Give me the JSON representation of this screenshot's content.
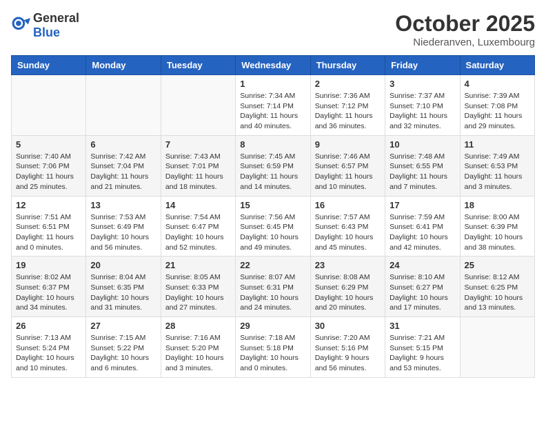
{
  "header": {
    "logo_general": "General",
    "logo_blue": "Blue",
    "month": "October 2025",
    "location": "Niederanven, Luxembourg"
  },
  "weekdays": [
    "Sunday",
    "Monday",
    "Tuesday",
    "Wednesday",
    "Thursday",
    "Friday",
    "Saturday"
  ],
  "weeks": [
    [
      {
        "day": "",
        "info": ""
      },
      {
        "day": "",
        "info": ""
      },
      {
        "day": "",
        "info": ""
      },
      {
        "day": "1",
        "info": "Sunrise: 7:34 AM\nSunset: 7:14 PM\nDaylight: 11 hours and 40 minutes."
      },
      {
        "day": "2",
        "info": "Sunrise: 7:36 AM\nSunset: 7:12 PM\nDaylight: 11 hours and 36 minutes."
      },
      {
        "day": "3",
        "info": "Sunrise: 7:37 AM\nSunset: 7:10 PM\nDaylight: 11 hours and 32 minutes."
      },
      {
        "day": "4",
        "info": "Sunrise: 7:39 AM\nSunset: 7:08 PM\nDaylight: 11 hours and 29 minutes."
      }
    ],
    [
      {
        "day": "5",
        "info": "Sunrise: 7:40 AM\nSunset: 7:06 PM\nDaylight: 11 hours and 25 minutes."
      },
      {
        "day": "6",
        "info": "Sunrise: 7:42 AM\nSunset: 7:04 PM\nDaylight: 11 hours and 21 minutes."
      },
      {
        "day": "7",
        "info": "Sunrise: 7:43 AM\nSunset: 7:01 PM\nDaylight: 11 hours and 18 minutes."
      },
      {
        "day": "8",
        "info": "Sunrise: 7:45 AM\nSunset: 6:59 PM\nDaylight: 11 hours and 14 minutes."
      },
      {
        "day": "9",
        "info": "Sunrise: 7:46 AM\nSunset: 6:57 PM\nDaylight: 11 hours and 10 minutes."
      },
      {
        "day": "10",
        "info": "Sunrise: 7:48 AM\nSunset: 6:55 PM\nDaylight: 11 hours and 7 minutes."
      },
      {
        "day": "11",
        "info": "Sunrise: 7:49 AM\nSunset: 6:53 PM\nDaylight: 11 hours and 3 minutes."
      }
    ],
    [
      {
        "day": "12",
        "info": "Sunrise: 7:51 AM\nSunset: 6:51 PM\nDaylight: 11 hours and 0 minutes."
      },
      {
        "day": "13",
        "info": "Sunrise: 7:53 AM\nSunset: 6:49 PM\nDaylight: 10 hours and 56 minutes."
      },
      {
        "day": "14",
        "info": "Sunrise: 7:54 AM\nSunset: 6:47 PM\nDaylight: 10 hours and 52 minutes."
      },
      {
        "day": "15",
        "info": "Sunrise: 7:56 AM\nSunset: 6:45 PM\nDaylight: 10 hours and 49 minutes."
      },
      {
        "day": "16",
        "info": "Sunrise: 7:57 AM\nSunset: 6:43 PM\nDaylight: 10 hours and 45 minutes."
      },
      {
        "day": "17",
        "info": "Sunrise: 7:59 AM\nSunset: 6:41 PM\nDaylight: 10 hours and 42 minutes."
      },
      {
        "day": "18",
        "info": "Sunrise: 8:00 AM\nSunset: 6:39 PM\nDaylight: 10 hours and 38 minutes."
      }
    ],
    [
      {
        "day": "19",
        "info": "Sunrise: 8:02 AM\nSunset: 6:37 PM\nDaylight: 10 hours and 34 minutes."
      },
      {
        "day": "20",
        "info": "Sunrise: 8:04 AM\nSunset: 6:35 PM\nDaylight: 10 hours and 31 minutes."
      },
      {
        "day": "21",
        "info": "Sunrise: 8:05 AM\nSunset: 6:33 PM\nDaylight: 10 hours and 27 minutes."
      },
      {
        "day": "22",
        "info": "Sunrise: 8:07 AM\nSunset: 6:31 PM\nDaylight: 10 hours and 24 minutes."
      },
      {
        "day": "23",
        "info": "Sunrise: 8:08 AM\nSunset: 6:29 PM\nDaylight: 10 hours and 20 minutes."
      },
      {
        "day": "24",
        "info": "Sunrise: 8:10 AM\nSunset: 6:27 PM\nDaylight: 10 hours and 17 minutes."
      },
      {
        "day": "25",
        "info": "Sunrise: 8:12 AM\nSunset: 6:25 PM\nDaylight: 10 hours and 13 minutes."
      }
    ],
    [
      {
        "day": "26",
        "info": "Sunrise: 7:13 AM\nSunset: 5:24 PM\nDaylight: 10 hours and 10 minutes."
      },
      {
        "day": "27",
        "info": "Sunrise: 7:15 AM\nSunset: 5:22 PM\nDaylight: 10 hours and 6 minutes."
      },
      {
        "day": "28",
        "info": "Sunrise: 7:16 AM\nSunset: 5:20 PM\nDaylight: 10 hours and 3 minutes."
      },
      {
        "day": "29",
        "info": "Sunrise: 7:18 AM\nSunset: 5:18 PM\nDaylight: 10 hours and 0 minutes."
      },
      {
        "day": "30",
        "info": "Sunrise: 7:20 AM\nSunset: 5:16 PM\nDaylight: 9 hours and 56 minutes."
      },
      {
        "day": "31",
        "info": "Sunrise: 7:21 AM\nSunset: 5:15 PM\nDaylight: 9 hours and 53 minutes."
      },
      {
        "day": "",
        "info": ""
      }
    ]
  ]
}
